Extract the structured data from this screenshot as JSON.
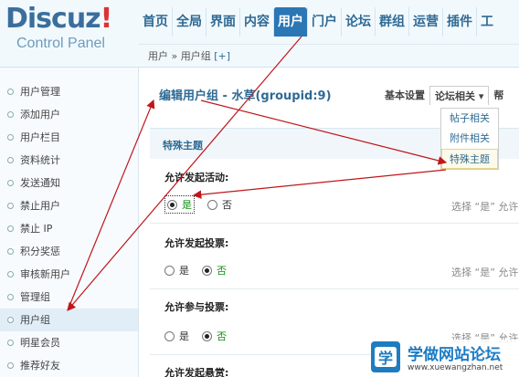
{
  "logo": {
    "main": "Discuz",
    "bang": "!",
    "sub": "Control Panel"
  },
  "topnav": [
    "首页",
    "全局",
    "界面",
    "内容",
    "用户",
    "门户",
    "论坛",
    "群组",
    "运营",
    "插件",
    "工"
  ],
  "breadcrumb": {
    "text": "用户 » 用户组",
    "add": "[+]"
  },
  "sidebar": [
    "用户管理",
    "添加用户",
    "用户栏目",
    "资料统计",
    "发送通知",
    "禁止用户",
    "禁止 IP",
    "积分奖惩",
    "审核新用户",
    "管理组",
    "用户组",
    "明星会员",
    "推荐好友"
  ],
  "main": {
    "title": "编辑用户组 - 水草(groupid:9)",
    "tabs": {
      "basic": "基本设置",
      "forum": "论坛相关 ▾",
      "more": "帮"
    },
    "dropdown": [
      "帖子相关",
      "附件相关",
      "特殊主题"
    ],
    "section": "特殊主题",
    "fields": [
      {
        "label": "允许发起活动:",
        "yes": "是",
        "no": "否",
        "hint": "选择 “是” 允许"
      },
      {
        "label": "允许发起投票:",
        "yes": "是",
        "no": "否",
        "hint": "选择 “是” 允许"
      },
      {
        "label": "允许参与投票:",
        "yes": "是",
        "no": "否",
        "hint": "选择 “是” 允许"
      },
      {
        "label": "允许发起悬赏:"
      }
    ]
  },
  "watermark": {
    "title": "学做网站论坛",
    "url": "www.xuewangzhan.net",
    "glyph": "学"
  },
  "colors": {
    "accent": "#2b77b5",
    "arrow": "#c0161b"
  }
}
